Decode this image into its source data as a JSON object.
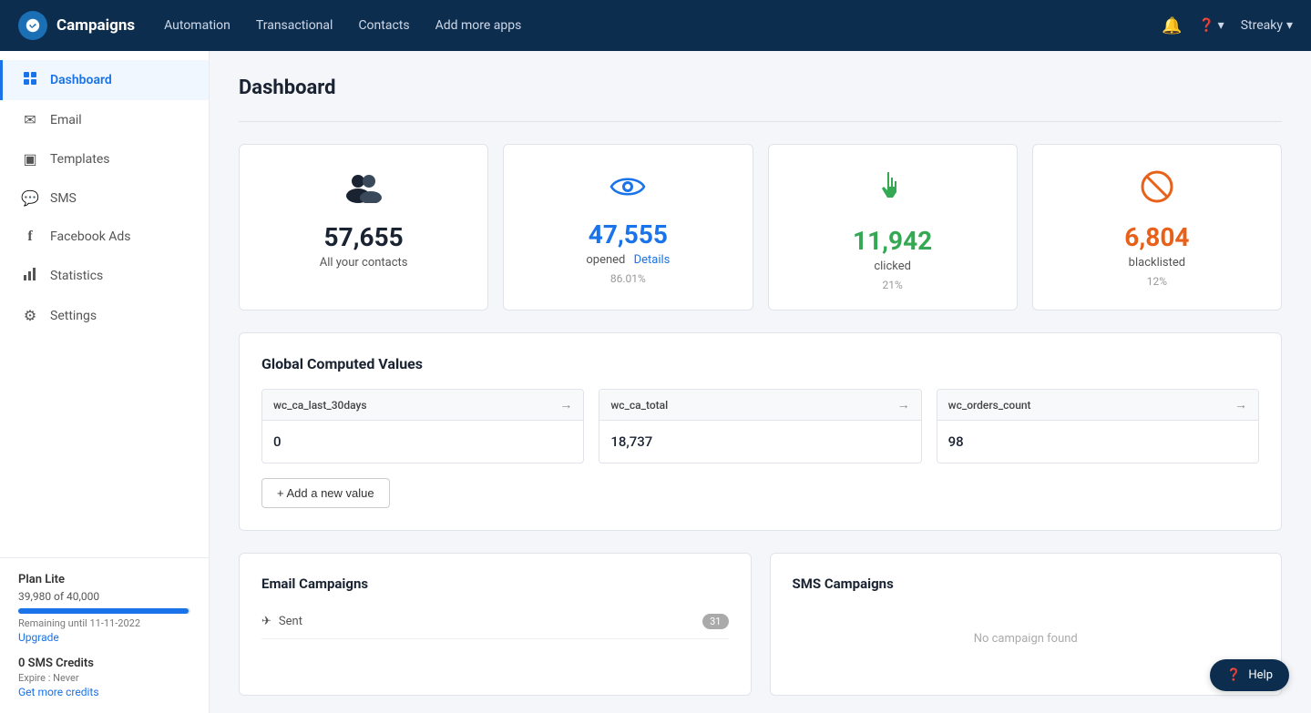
{
  "topnav": {
    "logo_label": "Campaigns",
    "links": [
      "Automation",
      "Transactional",
      "Contacts",
      "Add more apps"
    ],
    "user": "Streaky",
    "help_label": "?"
  },
  "sidebar": {
    "items": [
      {
        "id": "dashboard",
        "label": "Dashboard",
        "icon": "🏠",
        "active": true
      },
      {
        "id": "email",
        "label": "Email",
        "icon": "✉️",
        "active": false
      },
      {
        "id": "templates",
        "label": "Templates",
        "icon": "▣",
        "active": false
      },
      {
        "id": "sms",
        "label": "SMS",
        "icon": "💬",
        "active": false
      },
      {
        "id": "facebook-ads",
        "label": "Facebook Ads",
        "icon": "f",
        "active": false
      },
      {
        "id": "statistics",
        "label": "Statistics",
        "icon": "📊",
        "active": false
      },
      {
        "id": "settings",
        "label": "Settings",
        "icon": "⚙️",
        "active": false
      }
    ],
    "plan": {
      "title": "Plan Lite",
      "count": "39,980 of 40,000",
      "progress_percent": 99,
      "expire": "Remaining until 11-11-2022",
      "upgrade": "Upgrade"
    },
    "sms": {
      "title": "0 SMS Credits",
      "expire": "Expire : Never",
      "get_credits": "Get more credits"
    }
  },
  "page": {
    "title": "Dashboard"
  },
  "stat_cards": [
    {
      "id": "contacts",
      "icon": "👥",
      "value": "57,655",
      "label": "All your contacts",
      "sub": "",
      "color": "dark"
    },
    {
      "id": "opened",
      "icon": "👁",
      "value": "47,555",
      "label": "opened",
      "link": "Details",
      "sub": "86.01%",
      "color": "blue"
    },
    {
      "id": "clicked",
      "icon": "👆",
      "value": "11,942",
      "label": "clicked",
      "sub": "21%",
      "color": "green"
    },
    {
      "id": "blacklisted",
      "icon": "🚫",
      "value": "6,804",
      "label": "blacklisted",
      "sub": "12%",
      "color": "orange"
    }
  ],
  "global_computed": {
    "title": "Global Computed Values",
    "items": [
      {
        "key": "wc_ca_last_30days",
        "value": "0"
      },
      {
        "key": "wc_ca_total",
        "value": "18,737"
      },
      {
        "key": "wc_orders_count",
        "value": "98"
      }
    ],
    "add_btn": "+ Add a new value"
  },
  "email_campaigns": {
    "title": "Email Campaigns",
    "rows": [
      {
        "label": "Sent",
        "icon": "✈",
        "count": "31"
      }
    ]
  },
  "sms_campaigns": {
    "title": "SMS Campaigns",
    "empty": "No campaign found"
  },
  "help": {
    "label": "Help"
  }
}
